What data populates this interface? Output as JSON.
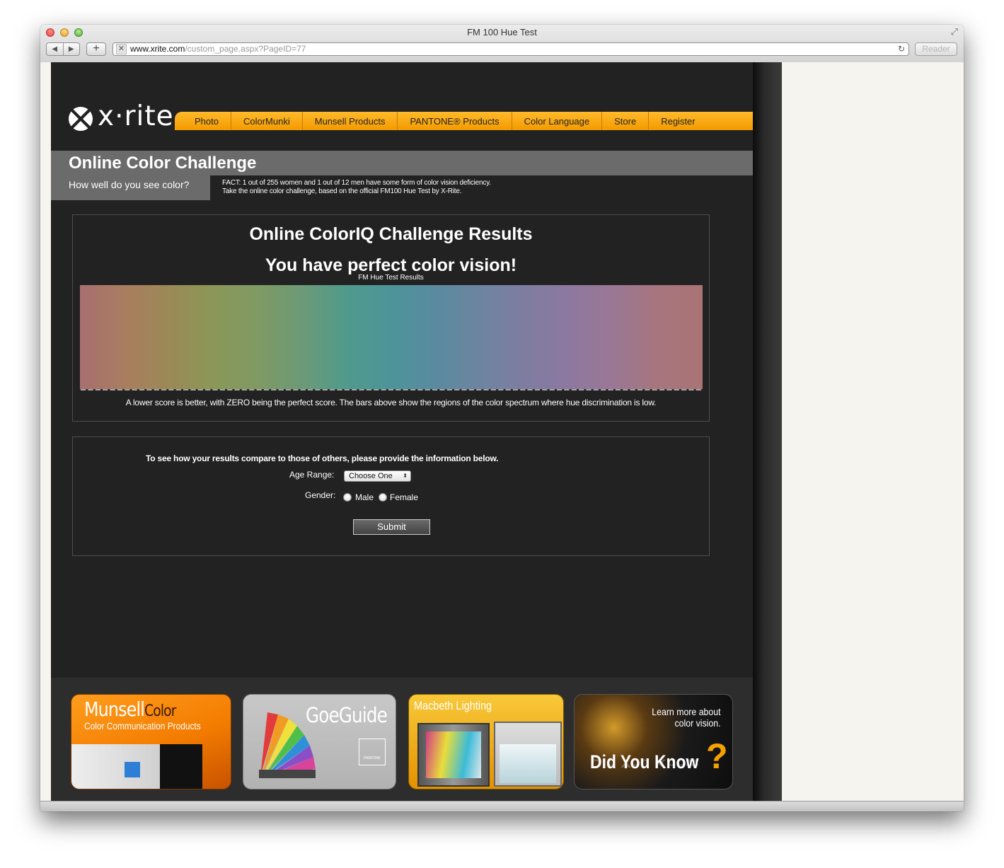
{
  "browser": {
    "window_title": "FM 100 Hue Test",
    "url_host": "www.xrite.com",
    "url_path": "/custom_page.aspx?PageID=77",
    "reader_label": "Reader",
    "back_icon": "◀",
    "forward_icon": "▶",
    "new_tab_icon": "+",
    "reload_icon": "↻",
    "fullscreen_icon": "⤢"
  },
  "brand": {
    "logo_text": "x·rite"
  },
  "nav": {
    "items": [
      "Photo",
      "ColorMunki",
      "Munsell Products",
      "PANTONE® Products",
      "Color Language",
      "Store",
      "Register"
    ]
  },
  "header": {
    "title": "Online Color Challenge",
    "subtitle": "How well do you see color?",
    "fact_line1": "FACT: 1 out of 255 women and 1 out of 12 men have some form of color vision deficiency.",
    "fact_line2": "Take the online color challenge, based on the official FM100 Hue Test by X-Rite."
  },
  "results": {
    "title": "Online ColorIQ Challenge Results",
    "message": "You have perfect color vision!",
    "note": "A lower score is better, with ZERO being the perfect score. The bars above show the regions of the color spectrum where hue discrimination is low."
  },
  "chart_data": {
    "type": "bar",
    "title": "FM Hue Test Results",
    "bar_count": 85,
    "values_note": "all hue discrimination error bars are zero (perfect score)",
    "values": [
      0,
      0,
      0,
      0,
      0,
      0,
      0,
      0,
      0,
      0,
      0,
      0,
      0,
      0,
      0,
      0,
      0,
      0,
      0,
      0,
      0,
      0,
      0,
      0,
      0,
      0,
      0,
      0,
      0,
      0,
      0,
      0,
      0,
      0,
      0,
      0,
      0,
      0,
      0,
      0,
      0,
      0,
      0,
      0,
      0,
      0,
      0,
      0,
      0,
      0,
      0,
      0,
      0,
      0,
      0,
      0,
      0,
      0,
      0,
      0,
      0,
      0,
      0,
      0,
      0,
      0,
      0,
      0,
      0,
      0,
      0,
      0,
      0,
      0,
      0,
      0,
      0,
      0,
      0,
      0,
      0,
      0,
      0,
      0,
      0
    ],
    "spectrum_colors": [
      "#a8706f",
      "#a87e5e",
      "#9a8a55",
      "#8a9757",
      "#7f9a64",
      "#6b9a78",
      "#4f9a8c",
      "#4c9499",
      "#5a8aa0",
      "#6d84a0",
      "#7e7da0",
      "#8c78a0",
      "#9a7795",
      "#a6757f",
      "#aa7474"
    ],
    "baseline_color": "#cfcfcf"
  },
  "form": {
    "intro": "To see how your results compare to those of others, please provide the information below.",
    "age_label": "Age Range:",
    "age_value": "Choose One",
    "age_arrow": "⬍",
    "gender_label": "Gender:",
    "male_label": "Male",
    "female_label": "Female",
    "submit_label": "Submit"
  },
  "promos": {
    "munsell_word": "Munsell",
    "munsell_color": "Color",
    "munsell_sub": "Color Communication Products",
    "goe_word": "GoeGuide",
    "goe_pantone": "PANTONE",
    "macbeth_word": "Macbeth Lighting",
    "dyk_learn1": "Learn more about",
    "dyk_learn2": "color vision.",
    "dyk_big": "Did You Know",
    "dyk_q": "?"
  },
  "colors": {
    "accent": "#f7a100",
    "page_bg": "#222222",
    "band": "#6b6b6b"
  }
}
